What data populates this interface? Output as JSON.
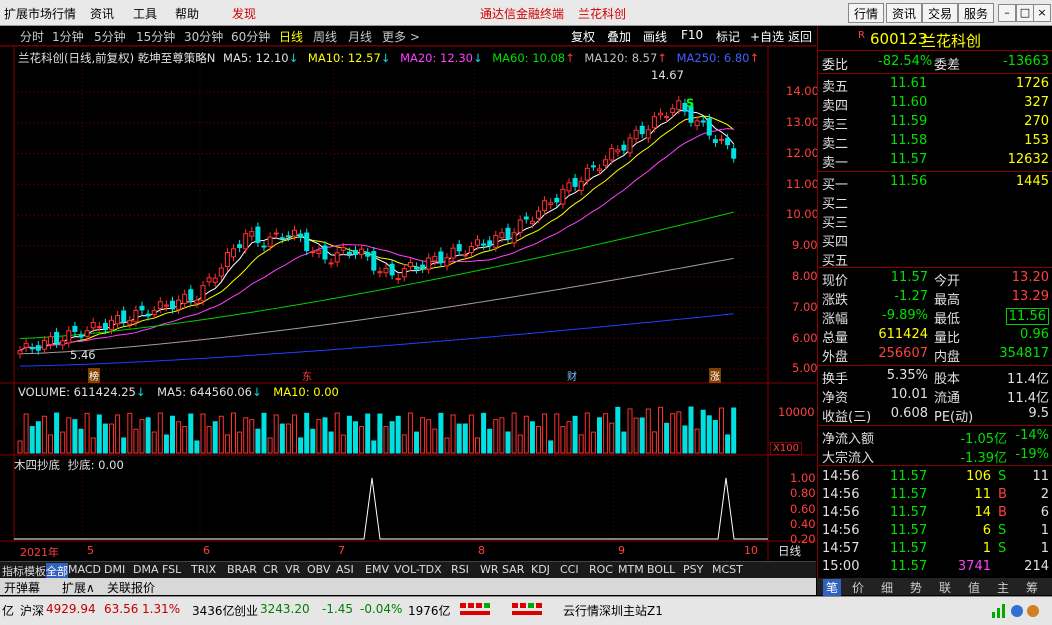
{
  "menu": {
    "items": [
      "扩展市场行情",
      "资讯",
      "工具",
      "帮助"
    ],
    "discover": "发现",
    "center_title": "通达信金融终端",
    "stock_title": "兰花科创",
    "right_buttons": [
      "行情",
      "资讯",
      "交易",
      "服务"
    ]
  },
  "periods": [
    "分时",
    "1分钟",
    "5分钟",
    "15分钟",
    "30分钟",
    "60分钟",
    "日线",
    "周线",
    "月线",
    "更多 >"
  ],
  "active_period": "日线",
  "tools": [
    "复权",
    "叠加",
    "画线",
    "F10",
    "标记",
    "+自选",
    "返回"
  ],
  "legend": {
    "title": "兰花科创(日线,前复权) 乾坤至尊策略N",
    "ma5": "MA5: 12.10",
    "ma10": "MA10: 12.57",
    "ma20": "MA20: 12.30",
    "ma60": "MA60: 10.08",
    "ma120": "MA120: 8.57",
    "ma250": "MA250: 6.80"
  },
  "volume_legend": {
    "volume": "VOLUME: 611424.25",
    "ma5": "MA5: 644560.06",
    "ma10": "MA10: 0.00"
  },
  "indicator_legend": {
    "name": "木四抄底",
    "value": "抄底: 0.00"
  },
  "price_axis": [
    "14.00",
    "13.00",
    "12.00",
    "11.00",
    "10.00",
    "9.00",
    "8.00",
    "7.00",
    "6.00",
    "5.00"
  ],
  "vol_axis": {
    "top": "10000",
    "mult": "X100"
  },
  "ind_axis": [
    "1.00",
    "0.80",
    "0.60",
    "0.40",
    "0.20",
    "0.00"
  ],
  "annotations": {
    "high": "14.67",
    "low": "5.46",
    "signal": "S"
  },
  "event_markers": [
    "榜",
    "东",
    "财",
    "涨"
  ],
  "date_axis": {
    "year": "2021年",
    "months": [
      "5",
      "6",
      "7",
      "8",
      "9",
      "10"
    ]
  },
  "period_label": "日线",
  "indicator_tabs": [
    "指标",
    "模板",
    "全部",
    "MACD",
    "DMI",
    "DMA",
    "FSL",
    "TRIX",
    "BRAR",
    "CR",
    "VR",
    "OBV",
    "ASI",
    "EMV",
    "VOL-TDX",
    "RSI",
    "WR",
    "SAR",
    "KDJ",
    "CCI",
    "ROC",
    "MTM",
    "BOLL",
    "PSY",
    "MCST"
  ],
  "bottom_tabs": [
    "开弹幕",
    "扩展∧",
    "关联报价"
  ],
  "quote": {
    "code": "600123",
    "name": "兰花科创",
    "flag": "R",
    "weibi_label": "委比",
    "weibi": "-82.54%",
    "weicha_label": "委差",
    "weicha": "-13663",
    "asks": [
      {
        "label": "卖五",
        "price": "11.61",
        "vol": "1726"
      },
      {
        "label": "卖四",
        "price": "11.60",
        "vol": "327"
      },
      {
        "label": "卖三",
        "price": "11.59",
        "vol": "270"
      },
      {
        "label": "卖二",
        "price": "11.58",
        "vol": "153"
      },
      {
        "label": "卖一",
        "price": "11.57",
        "vol": "12632"
      }
    ],
    "bids": [
      {
        "label": "买一",
        "price": "11.56",
        "vol": "1445"
      },
      {
        "label": "买二",
        "price": "",
        "vol": ""
      },
      {
        "label": "买三",
        "price": "",
        "vol": ""
      },
      {
        "label": "买四",
        "price": "",
        "vol": ""
      },
      {
        "label": "买五",
        "price": "",
        "vol": ""
      }
    ],
    "stats": [
      {
        "l1": "现价",
        "v1": "11.57",
        "c1": "g",
        "l2": "今开",
        "v2": "13.20",
        "c2": "r"
      },
      {
        "l1": "涨跌",
        "v1": "-1.27",
        "c1": "g",
        "l2": "最高",
        "v2": "13.29",
        "c2": "r"
      },
      {
        "l1": "涨幅",
        "v1": "-9.89%",
        "c1": "g",
        "l2": "最低",
        "v2": "11.56",
        "c2": "g"
      },
      {
        "l1": "总量",
        "v1": "611424",
        "c1": "y",
        "l2": "量比",
        "v2": "0.96",
        "c2": "g"
      },
      {
        "l1": "外盘",
        "v1": "256607",
        "c1": "r",
        "l2": "内盘",
        "v2": "354817",
        "c2": "g"
      }
    ],
    "stats2": [
      {
        "l1": "换手",
        "v1": "5.35%",
        "l2": "股本",
        "v2": "11.4亿"
      },
      {
        "l1": "净资",
        "v1": "10.01",
        "l2": "流通",
        "v2": "11.4亿"
      },
      {
        "l1": "收益(三)",
        "v1": "0.608",
        "l2": "PE(动)",
        "v2": "9.5"
      }
    ],
    "flows": [
      {
        "label": "净流入额",
        "value": "-1.05亿",
        "pct": "-14%"
      },
      {
        "label": "大宗流入",
        "value": "-1.39亿",
        "pct": "-19%"
      }
    ],
    "ticks": [
      {
        "time": "14:56",
        "price": "11.57",
        "vol": "106",
        "bs": "S",
        "n": "11"
      },
      {
        "time": "14:56",
        "price": "11.57",
        "vol": "11",
        "bs": "B",
        "n": "2"
      },
      {
        "time": "14:56",
        "price": "11.57",
        "vol": "14",
        "bs": "B",
        "n": "6"
      },
      {
        "time": "14:56",
        "price": "11.57",
        "vol": "6",
        "bs": "S",
        "n": "1"
      },
      {
        "time": "14:57",
        "price": "11.57",
        "vol": "1",
        "bs": "S",
        "n": "1"
      },
      {
        "time": "15:00",
        "price": "11.57",
        "vol": "3741",
        "bs": "",
        "n": "214"
      }
    ],
    "tabs": [
      "笔",
      "价",
      "细",
      "势",
      "联",
      "值",
      "主",
      "筹"
    ]
  },
  "status": {
    "left": "亿",
    "sh_label": "沪深",
    "sh_val": "4929.94",
    "sh_chg": "63.56",
    "sh_pct": "1.31%",
    "sh_amt": "3436亿",
    "cy_label": "创业",
    "cy_val": "3243.20",
    "cy_chg": "-1.45",
    "cy_pct": "-0.04%",
    "cy_amt": "1976亿",
    "server": "云行情深圳主站Z1"
  },
  "colors": {
    "up": "#ff3030",
    "down": "#00e0e0",
    "ma5": "#ffffff",
    "ma10": "#ffff00",
    "ma20": "#ff40ff",
    "ma60": "#00d000",
    "ma120": "#a0a0a0",
    "ma250": "#2040ff"
  }
}
